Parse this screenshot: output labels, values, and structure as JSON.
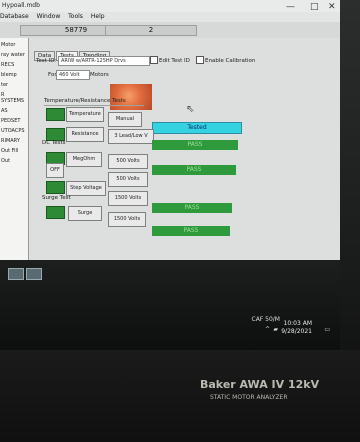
{
  "window": {
    "title": "Hypoall.mdb",
    "menu": [
      "Database",
      "Window",
      "Tools",
      "Help"
    ],
    "controls": [
      "—",
      "□",
      "✕"
    ]
  },
  "toolbar": {
    "id_value": "58779",
    "page_value": "2"
  },
  "sidebar": {
    "items": [
      "Motor",
      "ray water",
      "RECS",
      "blemp",
      "ter",
      "R SYSTEMS",
      "AS",
      "PEDSET",
      "UTOACPS",
      "RIMARY",
      "Out Fill",
      "Out"
    ]
  },
  "tabs": [
    "Tests",
    "Data",
    "Trending"
  ],
  "test_id": {
    "label": "Test ID:",
    "value": "ARIW w/ARTR-125HP Drvs",
    "edit_label": "Edit Test ID",
    "enable_calibration_label": "Enable Calibration"
  },
  "for": {
    "label": "For",
    "value": "460 Volt",
    "suffix": "Motors"
  },
  "sections": {
    "temperature_resistance": "Temperature/Resistance Tests",
    "dc_tests": "DC Tests",
    "surge_test": "Surge Test"
  },
  "buttons": {
    "temperature": "Temperature",
    "manual": "Manual",
    "resistance": "Resistance",
    "lead_lowv": "3 Lead/Low V",
    "megohm": "MegOhm",
    "mego_volts": "500 Volts",
    "off": "OFF",
    "pi_volts": "500 Volts",
    "step_voltage": "Step Voltage",
    "step_volts": "1500 Volts",
    "surge": "Surge",
    "surge_volts": "1500 Volts"
  },
  "status": {
    "temperature": "Tested",
    "resistance": "PASS",
    "megohm": "PASS",
    "step_voltage": "PASS",
    "surge": "PASS"
  },
  "colors": {
    "pass": "#2f9a3b",
    "tested": "#35d3e2",
    "indicator_green": "#2f8a36"
  },
  "taskbar": {
    "time": "10:03 AM",
    "date": "9/28/2021",
    "tag": "CAF 50/M"
  },
  "device": {
    "brand_line": "Baker AWA IV 12kV",
    "subline": "STATIC MOTOR ANALYZER"
  }
}
